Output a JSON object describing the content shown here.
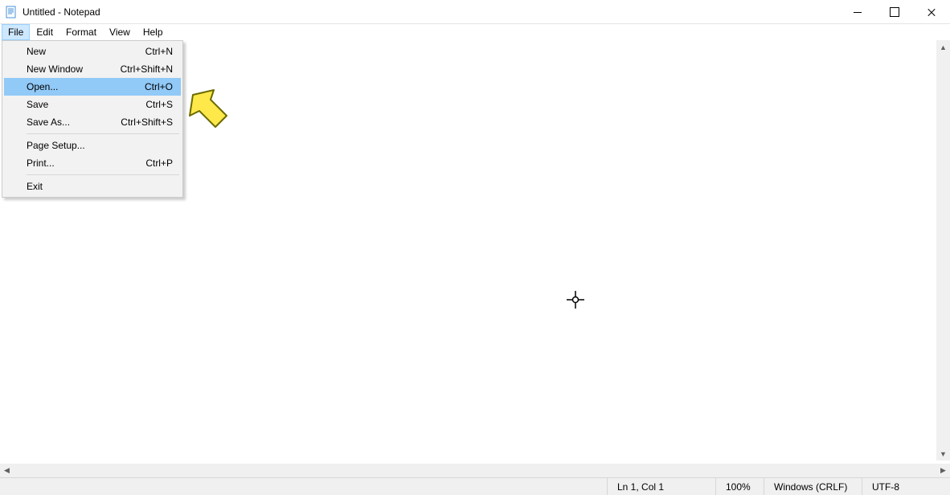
{
  "window": {
    "title": "Untitled - Notepad"
  },
  "menubar": {
    "items": [
      {
        "label": "File"
      },
      {
        "label": "Edit"
      },
      {
        "label": "Format"
      },
      {
        "label": "View"
      },
      {
        "label": "Help"
      }
    ]
  },
  "dropdown": {
    "items": [
      {
        "label": "New",
        "shortcut": "Ctrl+N"
      },
      {
        "label": "New Window",
        "shortcut": "Ctrl+Shift+N"
      },
      {
        "label": "Open...",
        "shortcut": "Ctrl+O",
        "highlight": true
      },
      {
        "label": "Save",
        "shortcut": "Ctrl+S"
      },
      {
        "label": "Save As...",
        "shortcut": "Ctrl+Shift+S"
      },
      {
        "sep": true
      },
      {
        "label": "Page Setup...",
        "shortcut": ""
      },
      {
        "label": "Print...",
        "shortcut": "Ctrl+P"
      },
      {
        "sep": true
      },
      {
        "label": "Exit",
        "shortcut": ""
      }
    ]
  },
  "statusbar": {
    "position": "Ln 1, Col 1",
    "zoom": "100%",
    "eol": "Windows (CRLF)",
    "encoding": "UTF-8"
  }
}
